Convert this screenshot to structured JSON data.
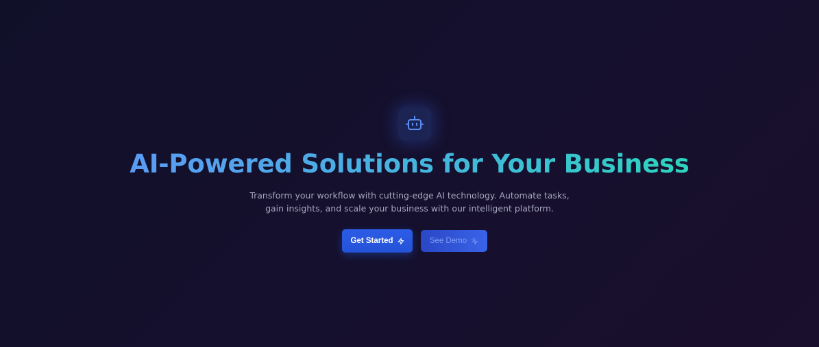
{
  "hero": {
    "logo_icon": "robot-icon",
    "headline": "AI-Powered Solutions for Your Business",
    "subtitle_line1": "Transform your workflow with cutting-edge AI technology. Automate tasks,",
    "subtitle_line2": "gain insights, and scale your business with our intelligent platform.",
    "colors": {
      "background": "#14102d",
      "headline_gradient_start": "#5b9bf5",
      "headline_gradient_end": "#2dd4bf",
      "primary_button": "#2453d8",
      "secondary_button": "#3a63e8"
    }
  },
  "buttons": {
    "primary_label": "Get Started",
    "primary_icon": "lightning-icon",
    "secondary_label": "See Demo",
    "secondary_icon": "cursor-click-icon"
  }
}
